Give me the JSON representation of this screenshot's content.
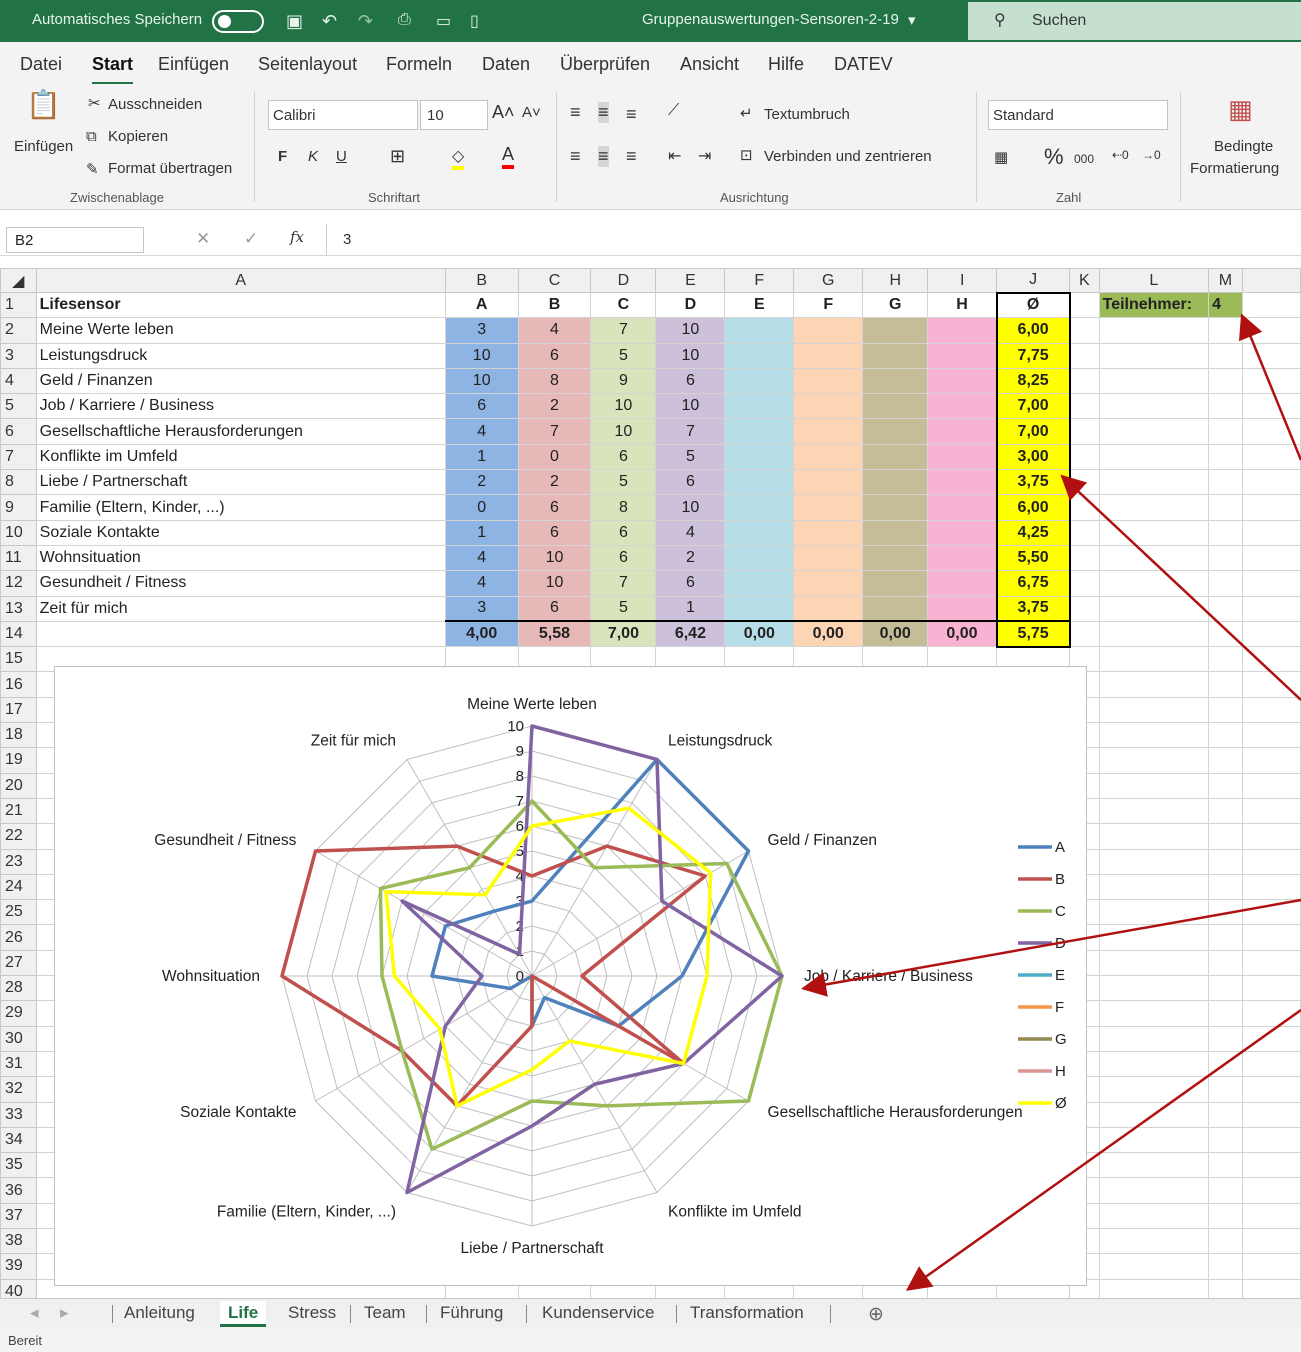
{
  "titlebar": {
    "autosave": "Automatisches Speichern",
    "filename": "Gruppenauswertungen-Sensoren-2-19",
    "search": "Suchen"
  },
  "menu": [
    "Datei",
    "Start",
    "Einfügen",
    "Seitenlayout",
    "Formeln",
    "Daten",
    "Überprüfen",
    "Ansicht",
    "Hilfe",
    "DATEV"
  ],
  "ribbon": {
    "paste": "Einfügen",
    "cut": "Ausschneiden",
    "copy": "Kopieren",
    "format_painter": "Format übertragen",
    "font": "Calibri",
    "size": "10",
    "bold": "F",
    "italic": "K",
    "underline": "U",
    "wrap": "Textumbruch",
    "merge": "Verbinden und zentrieren",
    "numformat": "Standard",
    "percent": "%",
    "thousands": "000",
    "cond1": "Bedingte",
    "cond2": "Formatierung",
    "groups": {
      "clipboard": "Zwischenablage",
      "font": "Schriftart",
      "align": "Ausrichtung",
      "number": "Zahl"
    }
  },
  "formula": {
    "cell": "B2",
    "fx": "fx",
    "value": "3"
  },
  "columns": [
    "A",
    "B",
    "C",
    "D",
    "E",
    "F",
    "G",
    "H",
    "I",
    "J",
    "K",
    "L",
    "M"
  ],
  "header_row": {
    "label": "Lifesensor",
    "cols": [
      "A",
      "B",
      "C",
      "D",
      "E",
      "F",
      "G",
      "H",
      "Ø"
    ]
  },
  "participants": {
    "label": "Teilnehmer:",
    "value": "4"
  },
  "rows": [
    {
      "label": "Meine Werte leben",
      "v": [
        "3",
        "4",
        "7",
        "10"
      ],
      "avg": "6,00"
    },
    {
      "label": "Leistungsdruck",
      "v": [
        "10",
        "6",
        "5",
        "10"
      ],
      "avg": "7,75"
    },
    {
      "label": "Geld / Finanzen",
      "v": [
        "10",
        "8",
        "9",
        "6"
      ],
      "avg": "8,25"
    },
    {
      "label": "Job / Karriere / Business",
      "v": [
        "6",
        "2",
        "10",
        "10"
      ],
      "avg": "7,00"
    },
    {
      "label": "Gesellschaftliche Herausforderungen",
      "v": [
        "4",
        "7",
        "10",
        "7"
      ],
      "avg": "7,00"
    },
    {
      "label": "Konflikte im Umfeld",
      "v": [
        "1",
        "0",
        "6",
        "5"
      ],
      "avg": "3,00"
    },
    {
      "label": "Liebe / Partnerschaft",
      "v": [
        "2",
        "2",
        "5",
        "6"
      ],
      "avg": "3,75"
    },
    {
      "label": "Familie (Eltern, Kinder, ...)",
      "v": [
        "0",
        "6",
        "8",
        "10"
      ],
      "avg": "6,00"
    },
    {
      "label": "Soziale Kontakte",
      "v": [
        "1",
        "6",
        "6",
        "4"
      ],
      "avg": "4,25"
    },
    {
      "label": "Wohnsituation",
      "v": [
        "4",
        "10",
        "6",
        "2"
      ],
      "avg": "5,50"
    },
    {
      "label": "Gesundheit / Fitness",
      "v": [
        "4",
        "10",
        "7",
        "6"
      ],
      "avg": "6,75"
    },
    {
      "label": "Zeit für mich",
      "v": [
        "3",
        "6",
        "5",
        "1"
      ],
      "avg": "3,75"
    }
  ],
  "totals": [
    "4,00",
    "5,58",
    "7,00",
    "6,42",
    "0,00",
    "0,00",
    "0,00",
    "0,00",
    "5,75"
  ],
  "sheets": [
    "Anleitung",
    "Life",
    "Stress",
    "Team",
    "Führung",
    "Kundenservice",
    "Transformation"
  ],
  "status": "Bereit",
  "chart_data": {
    "type": "radar",
    "categories": [
      "Meine Werte leben",
      "Leistungsdruck",
      "Geld / Finanzen",
      "Job / Karriere / Business",
      "Gesellschaftliche Herausforderungen",
      "Konflikte im Umfeld",
      "Liebe / Partnerschaft",
      "Familie (Eltern, Kinder, ...)",
      "Soziale Kontakte",
      "Wohnsituation",
      "Gesundheit / Fitness",
      "Zeit für mich"
    ],
    "ticks": [
      "0",
      "1",
      "2",
      "3",
      "4",
      "5",
      "6",
      "7",
      "8",
      "9",
      "10"
    ],
    "range": [
      0,
      10
    ],
    "legend": "right",
    "series": [
      {
        "name": "A",
        "color": "#4f81bd",
        "values": [
          3,
          10,
          10,
          6,
          4,
          1,
          2,
          0,
          1,
          4,
          4,
          3
        ]
      },
      {
        "name": "B",
        "color": "#c0504d",
        "values": [
          4,
          6,
          8,
          2,
          7,
          0,
          2,
          6,
          6,
          10,
          10,
          6
        ]
      },
      {
        "name": "C",
        "color": "#9bbb59",
        "values": [
          7,
          5,
          9,
          10,
          10,
          6,
          5,
          8,
          6,
          6,
          7,
          5
        ]
      },
      {
        "name": "D",
        "color": "#8064a2",
        "values": [
          10,
          10,
          6,
          10,
          7,
          5,
          6,
          10,
          4,
          2,
          6,
          1
        ]
      },
      {
        "name": "E",
        "color": "#4bacc6",
        "values": [
          0,
          0,
          0,
          0,
          0,
          0,
          0,
          0,
          0,
          0,
          0,
          0
        ]
      },
      {
        "name": "F",
        "color": "#f79646",
        "values": [
          0,
          0,
          0,
          0,
          0,
          0,
          0,
          0,
          0,
          0,
          0,
          0
        ]
      },
      {
        "name": "G",
        "color": "#948a54",
        "values": [
          0,
          0,
          0,
          0,
          0,
          0,
          0,
          0,
          0,
          0,
          0,
          0
        ]
      },
      {
        "name": "H",
        "color": "#d99694",
        "values": [
          0,
          0,
          0,
          0,
          0,
          0,
          0,
          0,
          0,
          0,
          0,
          0
        ]
      },
      {
        "name": "Ø",
        "color": "#ffff00",
        "values": [
          6,
          7.75,
          8.25,
          7,
          7,
          3,
          3.75,
          6,
          4.25,
          5.5,
          6.75,
          3.75
        ]
      }
    ]
  }
}
